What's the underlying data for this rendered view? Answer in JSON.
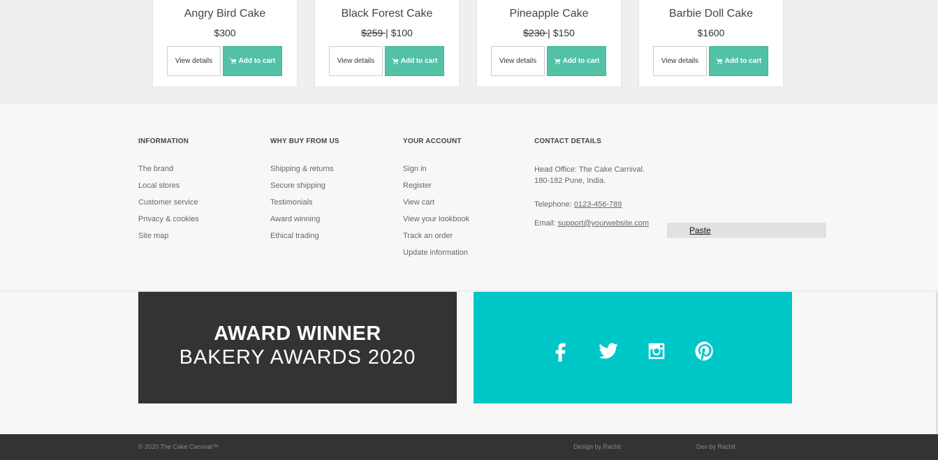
{
  "products": [
    {
      "name": "Angry Bird Cake",
      "old_price": "",
      "price": "$300",
      "details_label": "View details",
      "cart_label": "Add to cart"
    },
    {
      "name": "Black Forest Cake",
      "old_price": "$259 ",
      "price": "$100",
      "details_label": "View details",
      "cart_label": "Add to cart"
    },
    {
      "name": "Pineapple Cake",
      "old_price": "$230 ",
      "price": "$150",
      "details_label": "View details",
      "cart_label": "Add to cart"
    },
    {
      "name": "Barbie Doll Cake",
      "old_price": "",
      "price": "$1600",
      "details_label": "View details",
      "cart_label": "Add to cart"
    }
  ],
  "price_separator": "|",
  "footer": {
    "information": {
      "title": "INFORMATION",
      "links": [
        "The brand",
        "Local stores",
        "Customer service",
        "Privacy & cookies",
        "Site map"
      ]
    },
    "why_buy": {
      "title": "WHY BUY FROM US",
      "links": [
        "Shipping & returns",
        "Secure shipping",
        "Testimonials",
        "Award winning",
        "Ethical trading"
      ]
    },
    "account": {
      "title": "YOUR ACCOUNT",
      "links": [
        "Sign in",
        "Register",
        "View cart",
        "View your lookbook",
        "Track an order",
        "Update information"
      ]
    },
    "contact": {
      "title": "CONTACT DETAILS",
      "office_line1": "Head Office: The Cake Carnival.",
      "office_line2": "180-182 Pune, India.",
      "telephone_label": "Telephone: ",
      "telephone": "0123-456-789",
      "email_label": "Email: ",
      "email": "support@yourwebsite.com"
    }
  },
  "context_menu": {
    "paste": "Paste"
  },
  "award": {
    "line1": "AWARD WINNER",
    "line2": "BAKERY AWARDS 2020"
  },
  "social_icons": [
    "facebook-icon",
    "twitter-icon",
    "instagram-icon",
    "pinterest-icon"
  ],
  "bottom_bar": {
    "copyright": "© 2020 The Cake Carnival™",
    "design": "Design by Rachit",
    "dev": "Dev by Rachit"
  },
  "colors": {
    "accent": "#53c1a6",
    "social_bg": "#00c7c7",
    "dark": "#333333"
  }
}
